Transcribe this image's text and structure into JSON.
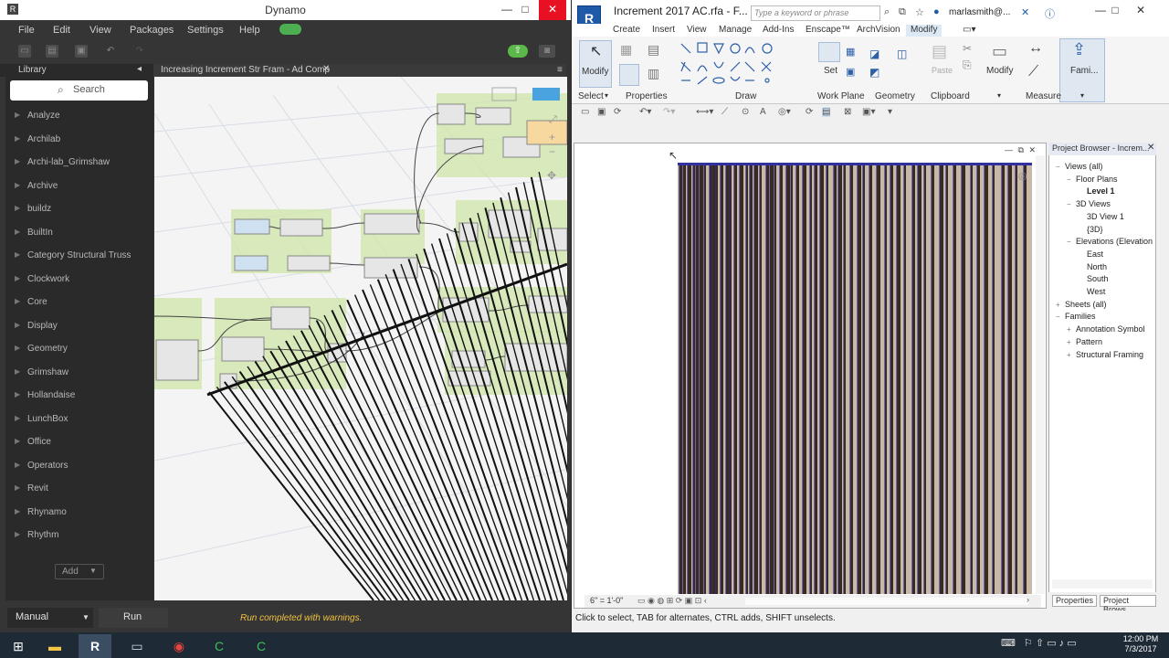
{
  "dynamo": {
    "title": "Dynamo",
    "menu": [
      "File",
      "Edit",
      "View",
      "Packages",
      "Settings",
      "Help"
    ],
    "library_label": "Library",
    "search_placeholder": "Search",
    "library_items": [
      "Analyze",
      "Archilab",
      "Archi-lab_Grimshaw",
      "Archive",
      "buildz",
      "BuiltIn",
      "Category Structural Truss",
      "Clockwork",
      "Core",
      "Display",
      "Geometry",
      "Grimshaw",
      "Hollandaise",
      "LunchBox",
      "Office",
      "Operators",
      "Revit",
      "Rhynamo",
      "Rhythm"
    ],
    "add_label": "Add",
    "tab_label": "Increasing Increment Str Fram - Ad Comp",
    "run_mode": "Manual",
    "run_label": "Run",
    "run_status": "Run completed with warnings."
  },
  "revit": {
    "title": "Increment 2017 AC.rfa - F...",
    "search_placeholder": "Type a keyword or phrase",
    "user": "marlasmith@...",
    "ribbon_tabs": [
      "Create",
      "Insert",
      "View",
      "Manage",
      "Add-Ins",
      "Enscape™",
      "ArchVision",
      "Modify"
    ],
    "active_tab": "Modify",
    "panels": {
      "select": "Select",
      "properties": "Properties",
      "draw": "Draw",
      "work_plane": "Work Plane",
      "geometry": "Geometry",
      "clipboard": "Clipboard",
      "measure": "Measure"
    },
    "buttons": {
      "modify": "Modify",
      "set": "Set",
      "paste": "Paste",
      "modify2": "Modify",
      "family": "Fami..."
    },
    "view_scale": "6\" = 1'-0\"",
    "project_browser_title": "Project Browser - Increm...",
    "project_browser": [
      {
        "label": "Views (all)",
        "depth": 0,
        "expander": "−"
      },
      {
        "label": "Floor Plans",
        "depth": 1,
        "expander": "−"
      },
      {
        "label": "Level 1",
        "depth": 2,
        "expander": "",
        "bold": true
      },
      {
        "label": "3D Views",
        "depth": 1,
        "expander": "−"
      },
      {
        "label": "3D View 1",
        "depth": 2,
        "expander": ""
      },
      {
        "label": "{3D}",
        "depth": 2,
        "expander": ""
      },
      {
        "label": "Elevations (Elevation",
        "depth": 1,
        "expander": "−"
      },
      {
        "label": "East",
        "depth": 2,
        "expander": ""
      },
      {
        "label": "North",
        "depth": 2,
        "expander": ""
      },
      {
        "label": "South",
        "depth": 2,
        "expander": ""
      },
      {
        "label": "West",
        "depth": 2,
        "expander": ""
      },
      {
        "label": "Sheets (all)",
        "depth": 0,
        "expander": "+"
      },
      {
        "label": "Families",
        "depth": 0,
        "expander": "−"
      },
      {
        "label": "Annotation Symbol",
        "depth": 1,
        "expander": "+"
      },
      {
        "label": "Pattern",
        "depth": 1,
        "expander": "+"
      },
      {
        "label": "Structural Framing",
        "depth": 1,
        "expander": "+"
      }
    ],
    "pb_tabs": [
      "Properties",
      "Project Brows..."
    ],
    "status_text": "Click to select, TAB for alternates, CTRL adds, SHIFT unselects."
  },
  "taskbar": {
    "time": "12:00 PM",
    "date": "7/3/2017"
  },
  "colors": {
    "dynamo_bg": "#353535",
    "run_status": "#f0c040",
    "revit_blue": "#1e5aa8",
    "stripe_dark": "#3a2a1e",
    "stripe_light": "#c8b8a8",
    "stripe_edge": "#3030a0"
  }
}
